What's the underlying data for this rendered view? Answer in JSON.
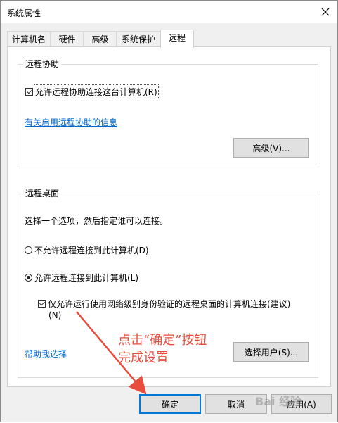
{
  "window": {
    "title": "系统属性"
  },
  "tabs": [
    {
      "label": "计算机名"
    },
    {
      "label": "硬件"
    },
    {
      "label": "高级"
    },
    {
      "label": "系统保护"
    },
    {
      "label": "远程"
    }
  ],
  "remote_assistance": {
    "group_label": "远程协助",
    "allow_checkbox_label": "允许远程协助连接这台计算机(R)",
    "allow_checked": true,
    "info_link": "有关启用远程协助的信息",
    "advanced_button": "高级(V)..."
  },
  "remote_desktop": {
    "group_label": "远程桌面",
    "instruction": "选择一个选项，然后指定谁可以连接。",
    "option_deny": "不允许远程连接到此计算机(D)",
    "option_allow": "允许远程连接到此计算机(L)",
    "selected_option": "allow",
    "nla_checkbox_line1": "仅允许运行使用网络级别身份验证的远程桌面的计算机连接(建议)",
    "nla_checkbox_line2": "(N)",
    "nla_checked": true,
    "help_link": "帮助我选择",
    "select_users_button": "选择用户(S)..."
  },
  "footer": {
    "ok_button": "确定",
    "cancel_button": "取消",
    "apply_button": "应用(A)"
  },
  "annotation": {
    "line1": "点击“确定”按钮",
    "line2": "完成设置",
    "color": "#e84c3d"
  },
  "watermark": {
    "text": "Bai 经验"
  }
}
